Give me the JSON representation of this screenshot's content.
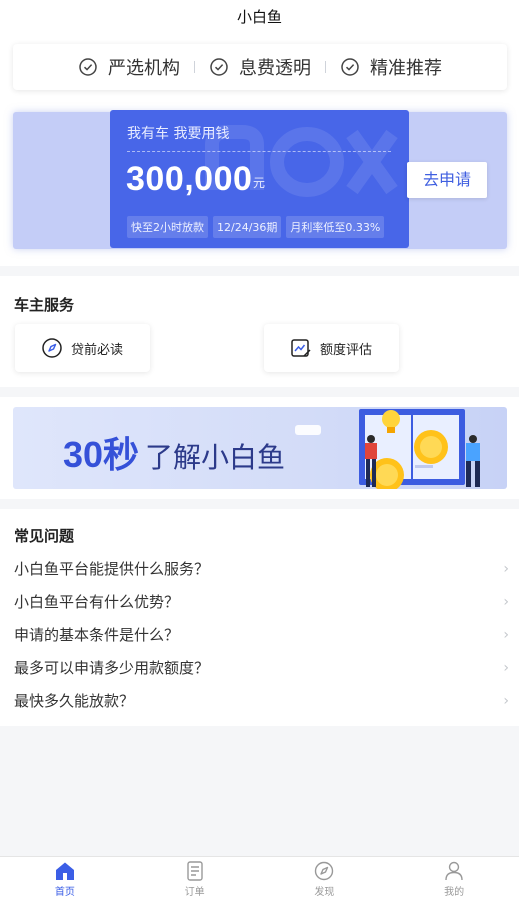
{
  "header": {
    "title": "小白鱼"
  },
  "features": [
    "严选机构",
    "息费透明",
    "精准推荐"
  ],
  "hero": {
    "subtitle": "我有车 我要用钱",
    "amount": "300,000",
    "unit": "元",
    "tags": [
      "快至2小时放款",
      "12/24/36期",
      "月利率低至0.33%"
    ],
    "apply_label": "去申请"
  },
  "service": {
    "title": "车主服务",
    "items": [
      {
        "label": "贷前必读",
        "icon": "compass-icon"
      },
      {
        "label": "额度评估",
        "icon": "chart-edit-icon"
      }
    ]
  },
  "banner": {
    "highlight": "30秒",
    "text": "了解小白鱼"
  },
  "faq": {
    "title": "常见问题",
    "items": [
      "小白鱼平台能提供什么服务？",
      "小白鱼平台有什么优势？",
      "申请的基本条件是什么？",
      "最多可以申请多少用款额度？",
      "最快多久能放款？"
    ]
  },
  "tabbar": {
    "items": [
      {
        "label": "首页",
        "active": true
      },
      {
        "label": "订单",
        "active": false
      },
      {
        "label": "发现",
        "active": false
      },
      {
        "label": "我的",
        "active": false
      }
    ]
  },
  "colors": {
    "accent": "#4866e8",
    "hero_bg": "#c4cdf7"
  }
}
